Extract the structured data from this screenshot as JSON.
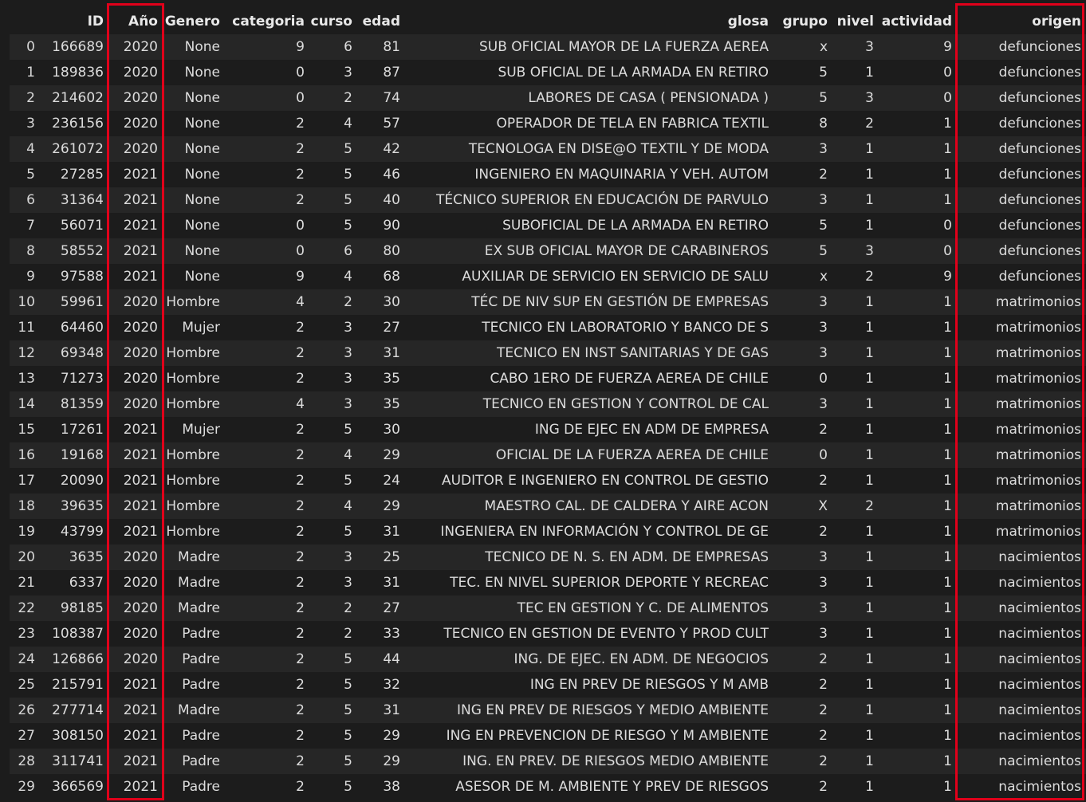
{
  "columns": [
    "",
    "ID",
    "Año",
    "Genero",
    "categoria",
    "curso",
    "edad",
    "glosa",
    "grupo",
    "nivel",
    "actividad",
    "origen"
  ],
  "rows": [
    [
      "0",
      "166689",
      "2020",
      "None",
      "9",
      "6",
      "81",
      "SUB OFICIAL MAYOR DE LA FUERZA AEREA",
      "x",
      "3",
      "9",
      "defunciones"
    ],
    [
      "1",
      "189836",
      "2020",
      "None",
      "0",
      "3",
      "87",
      "SUB OFICIAL DE LA ARMADA EN RETIRO",
      "5",
      "1",
      "0",
      "defunciones"
    ],
    [
      "2",
      "214602",
      "2020",
      "None",
      "0",
      "2",
      "74",
      "LABORES DE CASA ( PENSIONADA )",
      "5",
      "3",
      "0",
      "defunciones"
    ],
    [
      "3",
      "236156",
      "2020",
      "None",
      "2",
      "4",
      "57",
      "OPERADOR DE TELA EN FABRICA TEXTIL",
      "8",
      "2",
      "1",
      "defunciones"
    ],
    [
      "4",
      "261072",
      "2020",
      "None",
      "2",
      "5",
      "42",
      "TECNOLOGA EN DISE@O TEXTIL Y DE MODA",
      "3",
      "1",
      "1",
      "defunciones"
    ],
    [
      "5",
      "27285",
      "2021",
      "None",
      "2",
      "5",
      "46",
      "INGENIERO EN MAQUINARIA Y VEH. AUTOM",
      "2",
      "1",
      "1",
      "defunciones"
    ],
    [
      "6",
      "31364",
      "2021",
      "None",
      "2",
      "5",
      "40",
      "TÉCNICO SUPERIOR EN EDUCACIÓN DE PARVULO",
      "3",
      "1",
      "1",
      "defunciones"
    ],
    [
      "7",
      "56071",
      "2021",
      "None",
      "0",
      "5",
      "90",
      "SUBOFICIAL DE LA ARMADA EN RETIRO",
      "5",
      "1",
      "0",
      "defunciones"
    ],
    [
      "8",
      "58552",
      "2021",
      "None",
      "0",
      "6",
      "80",
      "EX SUB OFICIAL MAYOR DE CARABINEROS",
      "5",
      "3",
      "0",
      "defunciones"
    ],
    [
      "9",
      "97588",
      "2021",
      "None",
      "9",
      "4",
      "68",
      "AUXILIAR DE SERVICIO EN SERVICIO DE SALU",
      "x",
      "2",
      "9",
      "defunciones"
    ],
    [
      "10",
      "59961",
      "2020",
      "Hombre",
      "4",
      "2",
      "30",
      "TÉC DE NIV SUP EN GESTIÓN DE EMPRESAS",
      "3",
      "1",
      "1",
      "matrimonios"
    ],
    [
      "11",
      "64460",
      "2020",
      "Mujer",
      "2",
      "3",
      "27",
      "TECNICO EN LABORATORIO Y BANCO DE S",
      "3",
      "1",
      "1",
      "matrimonios"
    ],
    [
      "12",
      "69348",
      "2020",
      "Hombre",
      "2",
      "3",
      "31",
      "TECNICO EN INST SANITARIAS Y DE GAS",
      "3",
      "1",
      "1",
      "matrimonios"
    ],
    [
      "13",
      "71273",
      "2020",
      "Hombre",
      "2",
      "3",
      "35",
      "CABO 1ERO DE FUERZA AEREA DE CHILE",
      "0",
      "1",
      "1",
      "matrimonios"
    ],
    [
      "14",
      "81359",
      "2020",
      "Hombre",
      "4",
      "3",
      "35",
      "TECNICO EN GESTION Y CONTROL DE CAL",
      "3",
      "1",
      "1",
      "matrimonios"
    ],
    [
      "15",
      "17261",
      "2021",
      "Mujer",
      "2",
      "5",
      "30",
      "ING DE EJEC EN ADM DE EMPRESA",
      "2",
      "1",
      "1",
      "matrimonios"
    ],
    [
      "16",
      "19168",
      "2021",
      "Hombre",
      "2",
      "4",
      "29",
      "OFICIAL DE LA FUERZA AEREA DE CHILE",
      "0",
      "1",
      "1",
      "matrimonios"
    ],
    [
      "17",
      "20090",
      "2021",
      "Hombre",
      "2",
      "5",
      "24",
      "AUDITOR E INGENIERO EN CONTROL DE GESTIO",
      "2",
      "1",
      "1",
      "matrimonios"
    ],
    [
      "18",
      "39635",
      "2021",
      "Hombre",
      "2",
      "4",
      "29",
      "MAESTRO CAL. DE CALDERA Y AIRE ACON",
      "X",
      "2",
      "1",
      "matrimonios"
    ],
    [
      "19",
      "43799",
      "2021",
      "Hombre",
      "2",
      "5",
      "31",
      "INGENIERA EN INFORMACIÓN Y CONTROL DE GE",
      "2",
      "1",
      "1",
      "matrimonios"
    ],
    [
      "20",
      "3635",
      "2020",
      "Madre",
      "2",
      "3",
      "25",
      "TECNICO DE N. S. EN ADM. DE EMPRESAS",
      "3",
      "1",
      "1",
      "nacimientos"
    ],
    [
      "21",
      "6337",
      "2020",
      "Madre",
      "2",
      "3",
      "31",
      "TEC. EN NIVEL SUPERIOR DEPORTE Y RECREAC",
      "3",
      "1",
      "1",
      "nacimientos"
    ],
    [
      "22",
      "98185",
      "2020",
      "Madre",
      "2",
      "2",
      "27",
      "TEC EN GESTION Y C. DE ALIMENTOS",
      "3",
      "1",
      "1",
      "nacimientos"
    ],
    [
      "23",
      "108387",
      "2020",
      "Padre",
      "2",
      "2",
      "33",
      "TECNICO EN GESTION DE EVENTO Y PROD CULT",
      "3",
      "1",
      "1",
      "nacimientos"
    ],
    [
      "24",
      "126866",
      "2020",
      "Padre",
      "2",
      "5",
      "44",
      "ING. DE EJEC. EN ADM. DE NEGOCIOS",
      "2",
      "1",
      "1",
      "nacimientos"
    ],
    [
      "25",
      "215791",
      "2021",
      "Padre",
      "2",
      "5",
      "32",
      "ING EN PREV DE RIESGOS Y M AMB",
      "2",
      "1",
      "1",
      "nacimientos"
    ],
    [
      "26",
      "277714",
      "2021",
      "Madre",
      "2",
      "5",
      "31",
      "ING EN PREV DE RIESGOS Y MEDIO AMBIENTE",
      "2",
      "1",
      "1",
      "nacimientos"
    ],
    [
      "27",
      "308150",
      "2021",
      "Padre",
      "2",
      "5",
      "29",
      "ING EN PREVENCION DE RIESGO Y M AMBIENTE",
      "2",
      "1",
      "1",
      "nacimientos"
    ],
    [
      "28",
      "311741",
      "2021",
      "Padre",
      "2",
      "5",
      "29",
      "ING. EN PREV. DE RIESGOS MEDIO AMBIENTE",
      "2",
      "1",
      "1",
      "nacimientos"
    ],
    [
      "29",
      "366569",
      "2021",
      "Padre",
      "2",
      "5",
      "38",
      "ASESOR DE M. AMBIENTE Y PREV DE RIESGOS",
      "2",
      "1",
      "1",
      "nacimientos"
    ]
  ],
  "highlighted_columns": [
    "Año",
    "origen"
  ],
  "colors": {
    "background": "#1c1c1c",
    "row_stripe": "#262626",
    "text": "#dcdcdc",
    "highlight": "#e0001a"
  }
}
